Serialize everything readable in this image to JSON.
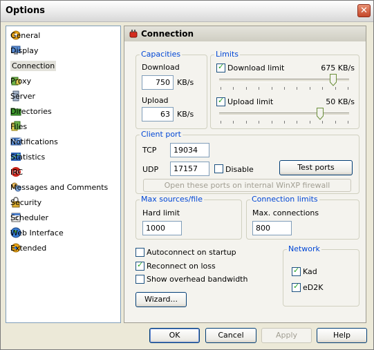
{
  "window": {
    "title": "Options",
    "close_glyph": "✕"
  },
  "sidebar": {
    "items": [
      {
        "label": "General",
        "icon": "gear-icon"
      },
      {
        "label": "Display",
        "icon": "display-icon"
      },
      {
        "label": "Connection",
        "icon": "connection-plug-icon",
        "selected": true
      },
      {
        "label": "Proxy",
        "icon": "proxy-icon"
      },
      {
        "label": "Server",
        "icon": "server-icon"
      },
      {
        "label": "Directories",
        "icon": "folder-icon"
      },
      {
        "label": "Files",
        "icon": "files-icon"
      },
      {
        "label": "Notifications",
        "icon": "notifications-icon"
      },
      {
        "label": "Statistics",
        "icon": "statistics-icon"
      },
      {
        "label": "IRC",
        "icon": "irc-icon"
      },
      {
        "label": "Messages and Comments",
        "icon": "messages-icon"
      },
      {
        "label": "Security",
        "icon": "lock-icon"
      },
      {
        "label": "Scheduler",
        "icon": "calendar-icon"
      },
      {
        "label": "Web Interface",
        "icon": "globe-icon"
      },
      {
        "label": "Extended",
        "icon": "extended-icon"
      }
    ]
  },
  "panel": {
    "title": "Connection",
    "capacities": {
      "legend": "Capacities",
      "download_label": "Download",
      "download_value": "750",
      "upload_label": "Upload",
      "upload_value": "63",
      "unit": "KB/s"
    },
    "limits": {
      "legend": "Limits",
      "download_limit_label": "Download limit",
      "download_limit_value": "675 KB/s",
      "download_limit_checked": true,
      "download_slider_fraction": 0.9,
      "upload_limit_label": "Upload limit",
      "upload_limit_value": "50 KB/s",
      "upload_limit_checked": true,
      "upload_slider_fraction": 0.79
    },
    "client_port": {
      "legend": "Client port",
      "tcp_label": "TCP",
      "tcp_value": "19034",
      "udp_label": "UDP",
      "udp_value": "17157",
      "disable_label": "Disable",
      "disable_checked": false,
      "test_ports_label": "Test ports",
      "firewall_label": "Open these ports on internal WinXP firewall"
    },
    "max_sources": {
      "legend": "Max sources/file",
      "hard_limit_label": "Hard limit",
      "hard_limit_value": "1000"
    },
    "connection_limits": {
      "legend": "Connection limits",
      "max_connections_label": "Max. connections",
      "max_connections_value": "800"
    },
    "options": {
      "autoconnect_label": "Autoconnect on startup",
      "autoconnect_checked": false,
      "reconnect_label": "Reconnect on loss",
      "reconnect_checked": true,
      "overhead_label": "Show overhead bandwidth",
      "overhead_checked": false
    },
    "network": {
      "legend": "Network",
      "kad_label": "Kad",
      "kad_checked": true,
      "ed2k_label": "eD2K",
      "ed2k_checked": true
    },
    "wizard_label": "Wizard..."
  },
  "footer": {
    "ok_label": "OK",
    "cancel_label": "Cancel",
    "apply_label": "Apply",
    "help_label": "Help"
  },
  "colors": {
    "legend_blue": "#0046d5",
    "close_red": "#c4472a",
    "check_green": "#21a121"
  }
}
